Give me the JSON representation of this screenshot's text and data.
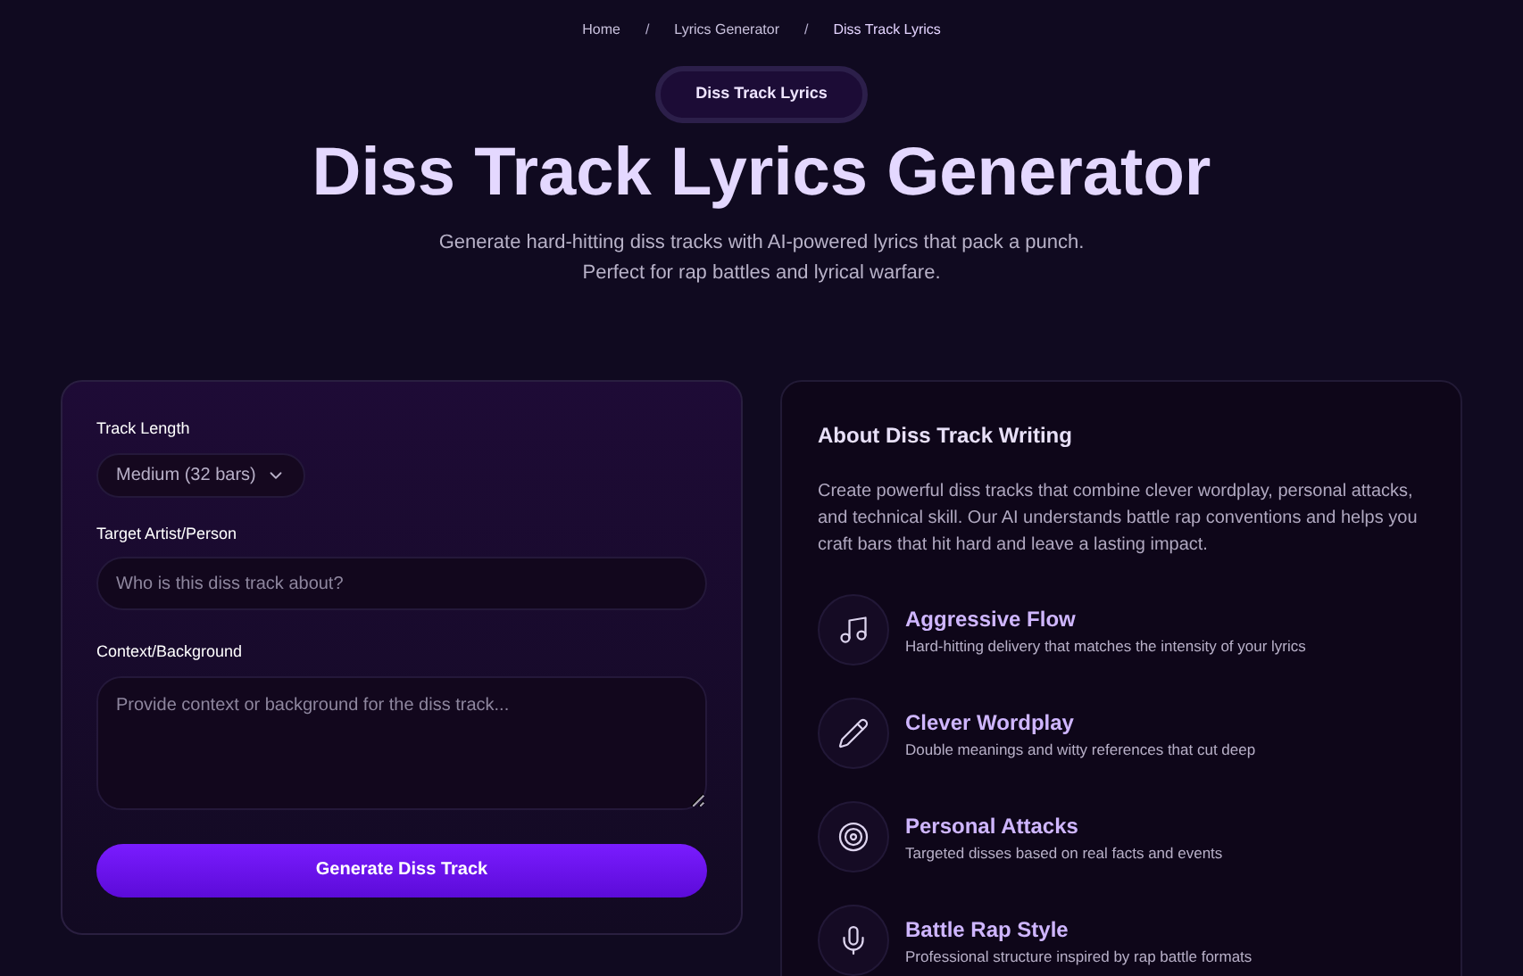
{
  "breadcrumb": [
    {
      "label": "Home",
      "current": false
    },
    {
      "label": "Lyrics Generator",
      "current": false
    },
    {
      "label": "Diss Track Lyrics",
      "current": true
    }
  ],
  "breadcrumb_separator": "/",
  "badge": "Diss Track Lyrics",
  "title": "Diss Track Lyrics Generator",
  "subtitle": [
    "Generate hard-hitting diss tracks with AI-powered lyrics that pack a punch.",
    "Perfect for rap battles and lyrical warfare."
  ],
  "form": {
    "track_length": {
      "label": "Track Length",
      "value": "Medium (32 bars)"
    },
    "target": {
      "label": "Target Artist/Person",
      "placeholder": "Who is this diss track about?"
    },
    "context": {
      "label": "Context/Background",
      "placeholder": "Provide context or background for the diss track..."
    },
    "button": "Generate Diss Track"
  },
  "about": {
    "title": "About Diss Track Writing",
    "text": "Create powerful diss tracks that combine clever wordplay, personal attacks, and technical skill. Our AI understands battle rap conventions and helps you craft bars that hit hard and leave a lasting impact.",
    "features": [
      {
        "title": "Aggressive Flow",
        "description": "Hard-hitting delivery that matches the intensity of your lyrics"
      },
      {
        "title": "Clever Wordplay",
        "description": "Double meanings and witty references that cut deep"
      },
      {
        "title": "Personal Attacks",
        "description": "Targeted disses based on real facts and events"
      },
      {
        "title": "Battle Rap Style",
        "description": "Professional structure inspired by rap battle formats"
      }
    ]
  }
}
